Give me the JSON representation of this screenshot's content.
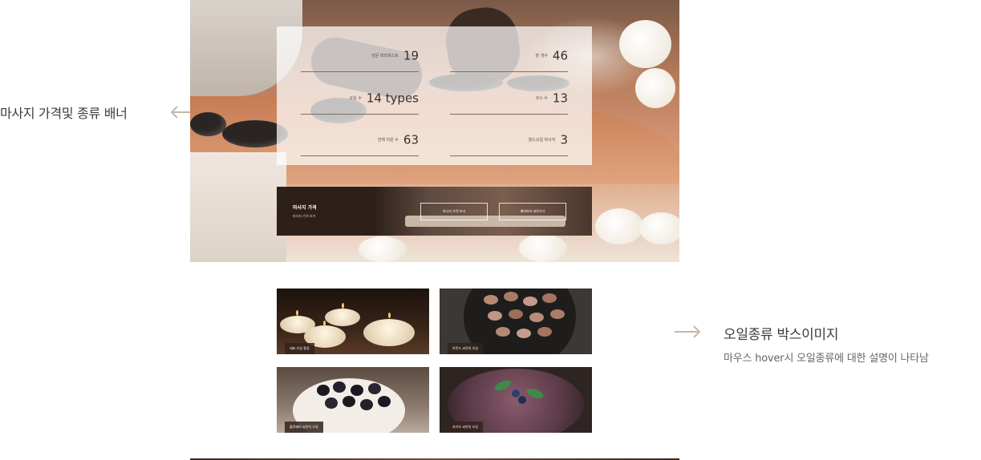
{
  "annotations": {
    "left_label": "마사지 가격및 종류 배너",
    "right_title": "오일종류 박스이미지",
    "right_desc": "마우스 hover시 오일종류에 대한 설명이 나타남",
    "arrow_color": "#c9b6a5"
  },
  "hero": {
    "stats": [
      {
        "label": "전문 테라피스트",
        "value": "19"
      },
      {
        "label": "방 개수",
        "value": "46"
      },
      {
        "label": "오일 수",
        "value": "14 types"
      },
      {
        "label": "코스 수",
        "value": "13"
      },
      {
        "label": "전체 직원 수",
        "value": "63"
      },
      {
        "label": "월드오일 마사지",
        "value": "3"
      }
    ],
    "price_bar": {
      "title": "마사지 가격",
      "subtitle": "마사지 가격 보기",
      "button_1": "마사지 가격 보기",
      "button_2": "예약하러 바로가기"
    }
  },
  "oils": [
    {
      "caption": "대표 오일 종류"
    },
    {
      "caption": "아몬드 씨앗의 오일"
    },
    {
      "caption": "블루베리 씨앗의 오일"
    },
    {
      "caption": "카카오 씨앗의 오일"
    }
  ],
  "colors": {
    "overlay": "#ffffff",
    "price_bar": "#2d1f1a",
    "caption_bg": "#32231c"
  }
}
